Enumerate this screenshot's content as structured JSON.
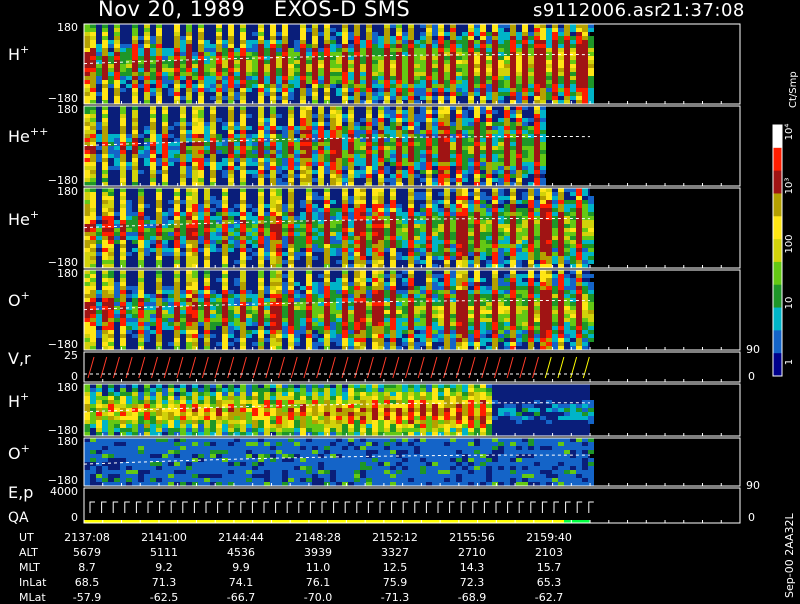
{
  "header": {
    "title": "Nov 20, 1989    EXOS-D SMS",
    "file": "s9112006.asr",
    "time": "21:37:08"
  },
  "colorbar": {
    "unit_label": "Ct/Smp",
    "ticks": [
      "10⁴",
      "10³",
      "100",
      "10",
      "1"
    ]
  },
  "side_label": "Sep-00  2AA32L",
  "bottom_table": {
    "row_labels": [
      "UT",
      "ALT",
      "MLT",
      "InLat",
      "MLat"
    ],
    "columns": [
      {
        "UT": "2137:08",
        "ALT": "5679",
        "MLT": "8.7",
        "InLat": "68.5",
        "MLat": "-57.9"
      },
      {
        "UT": "2141:00",
        "ALT": "5111",
        "MLT": "9.2",
        "InLat": "71.3",
        "MLat": "-62.5"
      },
      {
        "UT": "2144:44",
        "ALT": "4536",
        "MLT": "9.9",
        "InLat": "74.1",
        "MLat": "-66.7"
      },
      {
        "UT": "2148:28",
        "ALT": "3939",
        "MLT": "11.0",
        "InLat": "76.1",
        "MLat": "-70.0"
      },
      {
        "UT": "2152:12",
        "ALT": "3327",
        "MLT": "12.5",
        "InLat": "75.9",
        "MLat": "-71.3"
      },
      {
        "UT": "2155:56",
        "ALT": "2710",
        "MLT": "14.3",
        "InLat": "72.3",
        "MLat": "-68.9"
      },
      {
        "UT": "2159:40",
        "ALT": "2103",
        "MLT": "15.7",
        "InLat": "65.3",
        "MLat": "-62.7"
      }
    ]
  },
  "colors": {
    "background": "#000000",
    "panel_fill": "#0a1e7a",
    "spectrogram_scale": [
      "#00008b",
      "#1464c8",
      "#00b4c8",
      "#1e9628",
      "#64c814",
      "#d2d20a",
      "#ffe614",
      "#b4a000",
      "#ff1e00",
      "#a01414",
      "#ffffff"
    ],
    "trace": "#ffffff",
    "velocity_trace": "#ff3c2a",
    "qa_bar": "#ffff00",
    "qa_bar_end": "#00ff40"
  },
  "chart_data": [
    {
      "type": "heatmap",
      "label": "H+",
      "ylim": [
        -180,
        180
      ],
      "tick_top": "180",
      "tick_bottom": "−180",
      "intensity_peak": "10³"
    },
    {
      "type": "heatmap",
      "label": "He++",
      "ylim": [
        -180,
        180
      ],
      "tick_top": "180",
      "tick_bottom": "−180"
    },
    {
      "type": "heatmap",
      "label": "He+",
      "ylim": [
        -180,
        180
      ],
      "tick_top": "180",
      "tick_bottom": "−180"
    },
    {
      "type": "heatmap",
      "label": "O+",
      "ylim": [
        -180,
        180
      ],
      "tick_top": "180",
      "tick_bottom": "−180"
    },
    {
      "type": "line",
      "label": "V,r",
      "ylim": [
        0,
        25
      ],
      "tick_top": "25",
      "tick_bottom": "0",
      "right_top": "90",
      "right_bottom": "0"
    },
    {
      "type": "heatmap",
      "label": "H+",
      "ylim": [
        -180,
        180
      ],
      "tick_top": "180",
      "tick_bottom": "−180"
    },
    {
      "type": "heatmap",
      "label": "O+",
      "ylim": [
        -180,
        180
      ],
      "tick_top": "180",
      "tick_bottom": "−180"
    },
    {
      "type": "line",
      "label": "E,p",
      "label2": "QA",
      "ylim": [
        0,
        4000
      ],
      "tick_top": "4000",
      "tick_bottom": "0",
      "right_top": "90",
      "right_bottom": "0"
    }
  ]
}
